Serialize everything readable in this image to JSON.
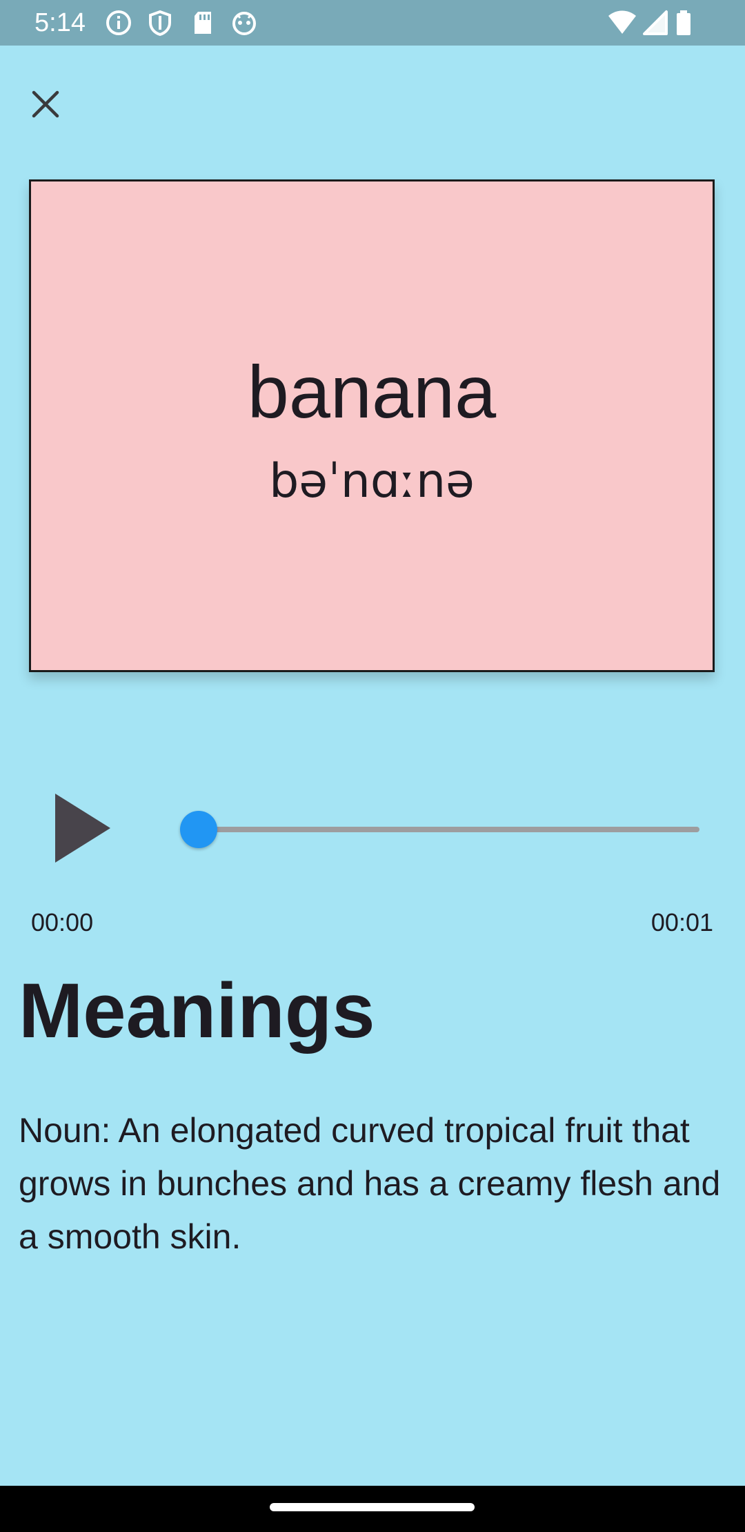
{
  "status_bar": {
    "time": "5:14",
    "left_icons": [
      "info-icon",
      "shield-icon",
      "sd-card-icon",
      "android-debug-icon"
    ],
    "right_icons": [
      "wifi-icon",
      "signal-icon",
      "battery-icon"
    ]
  },
  "header": {
    "close_icon": "close-icon"
  },
  "card": {
    "word": "banana",
    "phonetic": "bəˈnɑːnə",
    "background_color": "#f9c8ca"
  },
  "audio_player": {
    "play_icon": "play-icon",
    "current_time": "00:00",
    "total_time": "00:01",
    "progress": 0,
    "accent_color": "#2196f3"
  },
  "meanings": {
    "heading": "Meanings",
    "definition": "Noun: An elongated curved tropical fruit that grows in bunches and has a creamy flesh and a smooth skin."
  },
  "theme": {
    "background": "#a5e4f4",
    "status_bar": "#79aab8"
  }
}
